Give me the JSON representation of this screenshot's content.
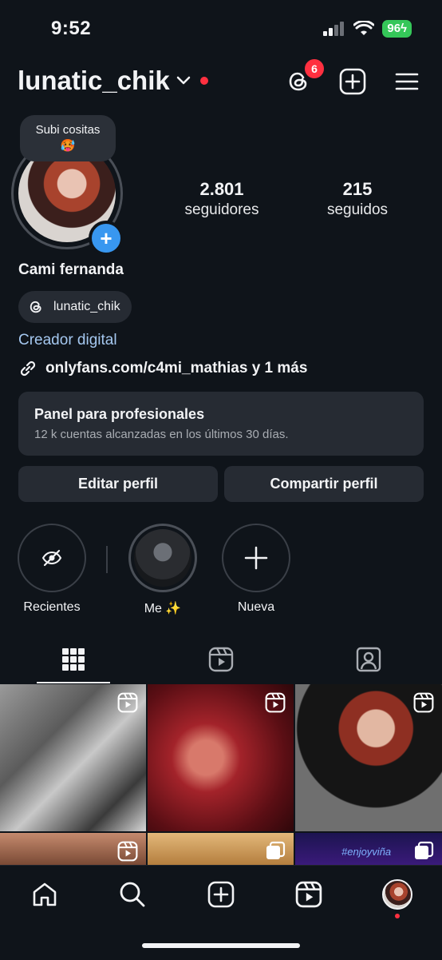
{
  "status_bar": {
    "time": "9:52",
    "battery": "96"
  },
  "header": {
    "username": "lunatic_chik",
    "threads_badge_count": "6"
  },
  "profile": {
    "note": {
      "text": "Subi cositas",
      "emoji": "🥵"
    },
    "display_name": "Cami fernanda",
    "threads_handle": "lunatic_chik",
    "category": "Creador digital",
    "link": "onlyfans.com/c4mi_mathias y 1 más",
    "stats": [
      {
        "value": "2.801",
        "label": "seguidores"
      },
      {
        "value": "215",
        "label": "seguidos"
      }
    ]
  },
  "dashboard": {
    "title": "Panel para profesionales",
    "subtitle": "12 k cuentas alcanzadas en los últimos 30 días."
  },
  "actions": {
    "edit": "Editar perfil",
    "share": "Compartir perfil"
  },
  "highlights": [
    {
      "label": "Recientes",
      "icon": "eye-off-icon"
    },
    {
      "label": "Me ✨",
      "icon": "image"
    },
    {
      "label": "Nueva",
      "icon": "plus-icon"
    }
  ],
  "tabs": [
    {
      "name": "grid",
      "icon": "grid-icon",
      "active": true
    },
    {
      "name": "reels",
      "icon": "reels-icon",
      "active": false
    },
    {
      "name": "tagged",
      "icon": "tagged-icon",
      "active": false
    }
  ],
  "grid_posts": [
    {
      "overlay": "#enjoyviña"
    }
  ],
  "colors": {
    "background": "#0f141a",
    "surface": "#262b33",
    "accent_blue": "#3897f0",
    "link_blue": "#a5c8f0",
    "badge_red": "#ff3040",
    "battery_green": "#35c759"
  }
}
